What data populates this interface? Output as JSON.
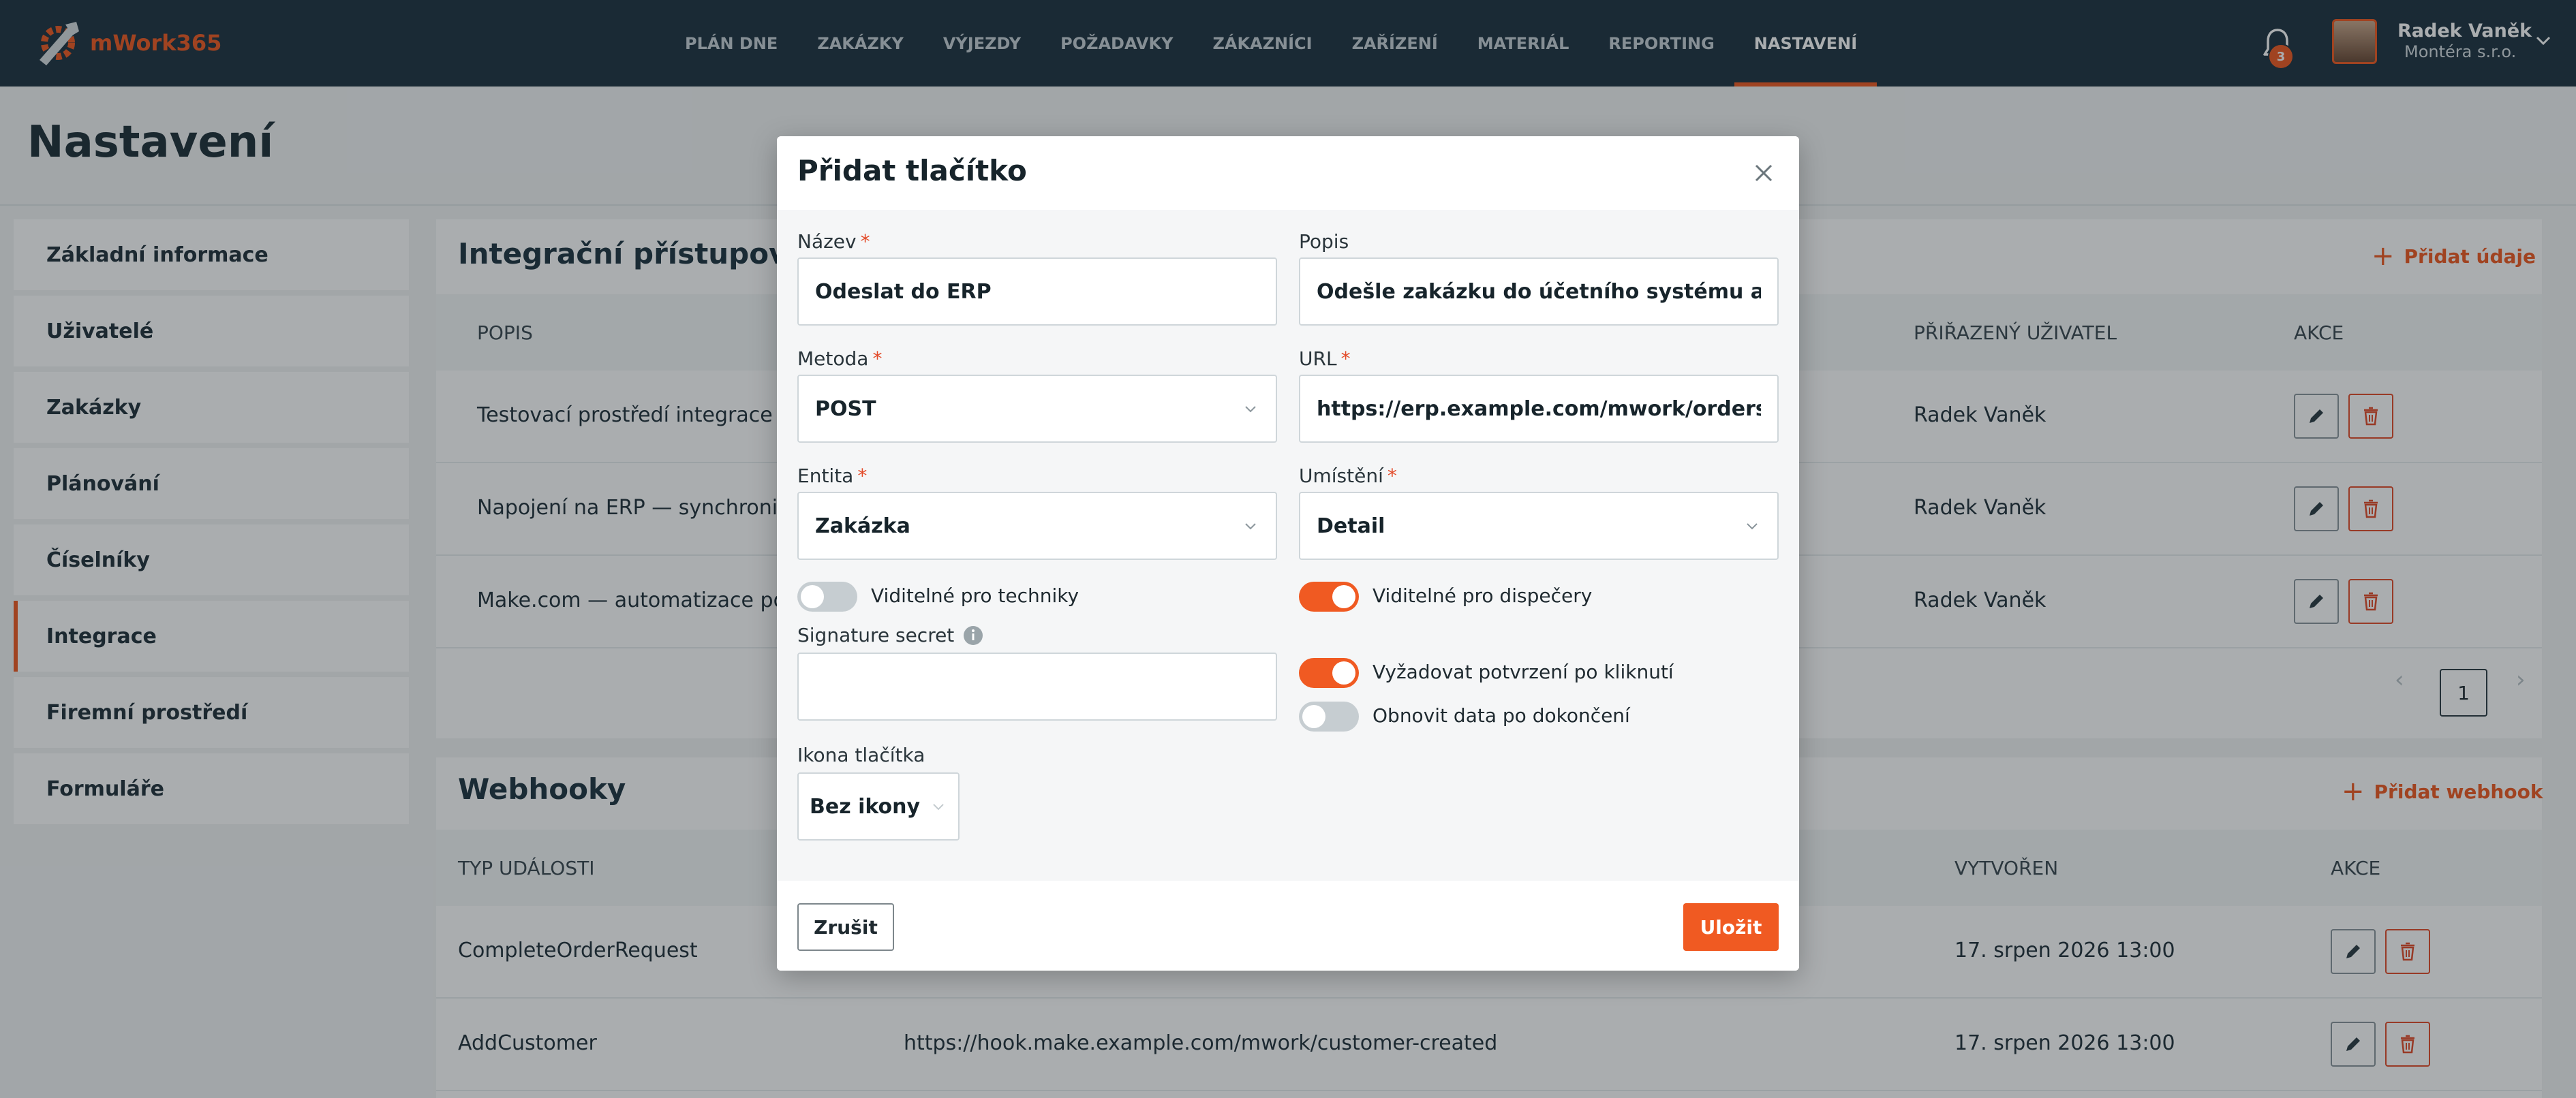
{
  "colors": {
    "accent": "#f05a22",
    "header_bg": "#1e3340",
    "danger": "#e34b2a"
  },
  "header": {
    "logo_text": "mWork365",
    "nav": [
      {
        "label": "PLÁN DNE",
        "active": false
      },
      {
        "label": "ZAKÁZKY",
        "active": false
      },
      {
        "label": "VÝJEZDY",
        "active": false
      },
      {
        "label": "POŽADAVKY",
        "active": false
      },
      {
        "label": "ZÁKAZNÍCI",
        "active": false
      },
      {
        "label": "ZAŘÍZENÍ",
        "active": false
      },
      {
        "label": "MATERIÁL",
        "active": false
      },
      {
        "label": "REPORTING",
        "active": false
      },
      {
        "label": "NASTAVENÍ",
        "active": true
      }
    ],
    "notification_count": "3",
    "user_name": "Radek Vaněk",
    "user_company": "Montéra s.r.o."
  },
  "page": {
    "title": "Nastavení"
  },
  "sidebar": {
    "items": [
      {
        "label": "Základní informace",
        "active": false
      },
      {
        "label": "Uživatelé",
        "active": false
      },
      {
        "label": "Zakázky",
        "active": false
      },
      {
        "label": "Plánování",
        "active": false
      },
      {
        "label": "Číselníky",
        "active": false
      },
      {
        "label": "Integrace",
        "active": true
      },
      {
        "label": "Firemní prostředí",
        "active": false
      },
      {
        "label": "Formuláře",
        "active": false
      }
    ]
  },
  "integrations": {
    "title": "Integrační přístupové ú",
    "add_label": "Přidat údaje",
    "columns": [
      "POPIS",
      "PŘIŘAZENÝ UŽIVATEL",
      "AKCE"
    ],
    "rows": [
      {
        "description": "Testovací prostředí integrace",
        "user": "Radek Vaněk"
      },
      {
        "description": "Napojení na ERP — synchroniza",
        "user": "Radek Vaněk"
      },
      {
        "description": "Make.com — automatizace pož",
        "user": "Radek Vaněk"
      }
    ],
    "pagination": {
      "current_page": "1",
      "prev": "‹",
      "next": "›"
    }
  },
  "webhooks": {
    "title": "Webhooky",
    "add_label": "Přidat webhook",
    "columns": [
      "TYP UDÁLOSTI",
      "VYTVOŘEN",
      "AKCE"
    ],
    "rows": [
      {
        "event": "CompleteOrderRequest",
        "url": "",
        "created": "17. srpen 2026 13:00"
      },
      {
        "event": "AddCustomer",
        "url": "https://hook.make.example.com/mwork/customer-created",
        "created": "17. srpen 2026 13:00"
      }
    ]
  },
  "modal": {
    "title": "Přidat tlačítko",
    "fields": {
      "name": {
        "label": "Název",
        "value": "Odeslat do ERP"
      },
      "description": {
        "label": "Popis",
        "value": "Odešle zakázku do účetního systému a vrátí čís"
      },
      "method": {
        "label": "Metoda",
        "value": "POST"
      },
      "url": {
        "label": "URL",
        "value": "https://erp.example.com/mwork/orders/{id}"
      },
      "entity": {
        "label": "Entita",
        "value": "Zakázka"
      },
      "placement": {
        "label": "Umístění",
        "value": "Detail"
      },
      "signature": {
        "label": "Signature secret",
        "value": ""
      },
      "icon": {
        "label": "Ikona tlačítka",
        "value": "Bez ikony"
      }
    },
    "required_mark": "*",
    "toggles": {
      "technicians": {
        "label": "Viditelné pro techniky",
        "on": false
      },
      "dispatchers": {
        "label": "Viditelné pro dispečery",
        "on": true
      },
      "confirm": {
        "label": "Vyžadovat potvrzení po kliknutí",
        "on": true
      },
      "refresh": {
        "label": "Obnovit data po dokončení",
        "on": false
      }
    },
    "cancel_label": "Zrušit",
    "save_label": "Uložit"
  }
}
